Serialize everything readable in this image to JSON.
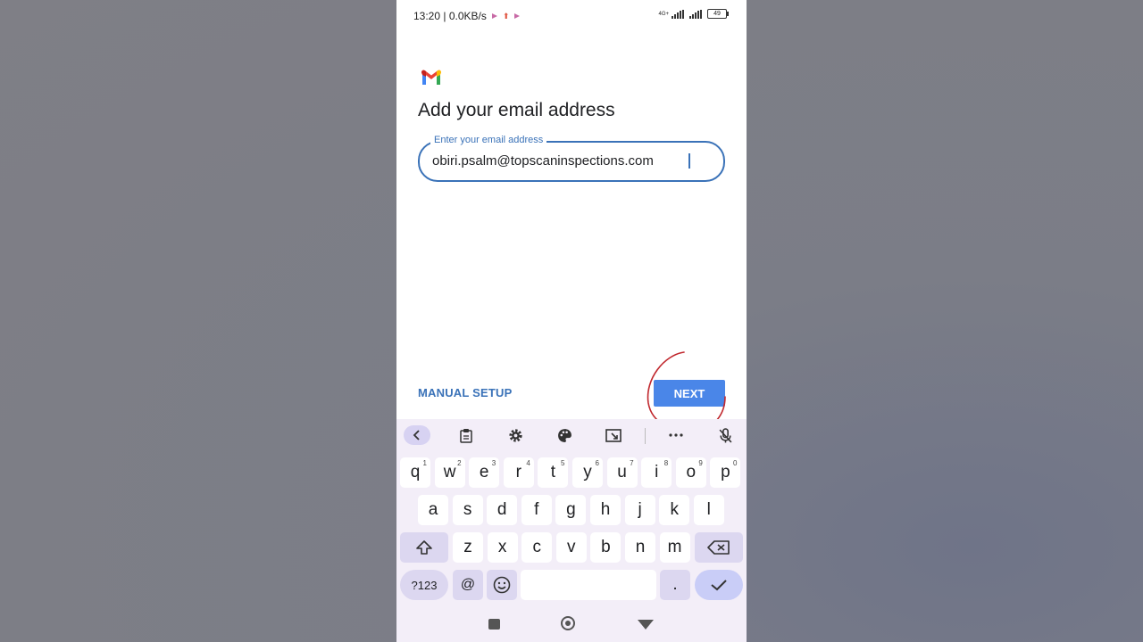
{
  "status_bar": {
    "time_speed": "13:20 | 0.0KB/s",
    "network_label": "4G+",
    "battery": "49"
  },
  "screen": {
    "title": "Add your email address",
    "email_field": {
      "label": "Enter your email address",
      "value": "obiri.psalm@topscaninspections.com"
    },
    "manual_setup_label": "MANUAL SETUP",
    "next_label": "NEXT"
  },
  "keyboard": {
    "toolbar_icons": [
      "chevron-left-icon",
      "clipboard-icon",
      "gear-icon",
      "palette-icon",
      "resize-icon",
      "more-icon",
      "mic-off-icon"
    ],
    "row1": [
      {
        "key": "q",
        "hint": "1"
      },
      {
        "key": "w",
        "hint": "2"
      },
      {
        "key": "e",
        "hint": "3"
      },
      {
        "key": "r",
        "hint": "4"
      },
      {
        "key": "t",
        "hint": "5"
      },
      {
        "key": "y",
        "hint": "6"
      },
      {
        "key": "u",
        "hint": "7"
      },
      {
        "key": "i",
        "hint": "8"
      },
      {
        "key": "o",
        "hint": "9"
      },
      {
        "key": "p",
        "hint": "0"
      }
    ],
    "row2": [
      "a",
      "s",
      "d",
      "f",
      "g",
      "h",
      "j",
      "k",
      "l"
    ],
    "row3": [
      "z",
      "x",
      "c",
      "v",
      "b",
      "n",
      "m"
    ],
    "symbols_label": "?123",
    "at_label": "@",
    "period_label": "."
  },
  "colors": {
    "accent": "#3a72b8",
    "next_button": "#4a86e8",
    "keyboard_bg": "#f3eef8",
    "annotation": "#c0272d"
  }
}
